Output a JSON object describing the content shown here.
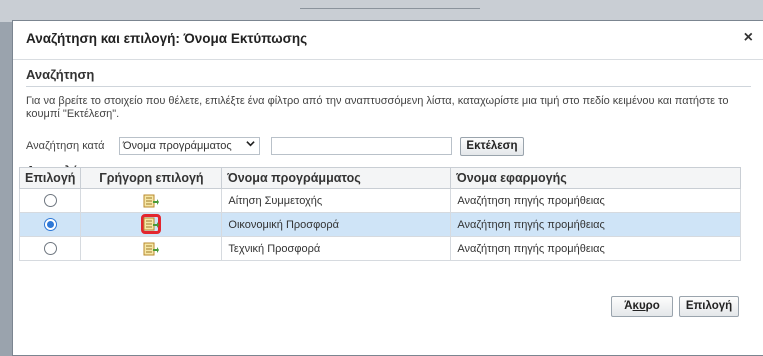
{
  "dialog": {
    "title": "Αναζήτηση και επιλογή: Όνομα Εκτύπωσης",
    "close_glyph": "×"
  },
  "search": {
    "section_title": "Αναζήτηση",
    "help_text": "Για να βρείτε το στοιχείο που θέλετε, επιλέξτε ένα φίλτρο από την αναπτυσσόμενη λίστα, καταχωρίστε μια τιμή στο πεδίο κειμένου και πατήστε το κουμπί \"Εκτέλεση\".",
    "search_by_label": "Αναζήτηση κατά",
    "filter_selected": "Όνομα προγράμματος",
    "value": "",
    "execute_label": "Εκτέλεση"
  },
  "results": {
    "section_title": "Αποτελέσματα",
    "columns": [
      "Επιλογή",
      "Γρήγορη επιλογή",
      "Όνομα προγράμματος",
      "Όνομα εφαρμογής"
    ],
    "rows": [
      {
        "program": "Αίτηση Συμμετοχής",
        "application": "Αναζήτηση πηγής προμήθειας",
        "selected": false
      },
      {
        "program": "Οικονομική Προσφορά",
        "application": "Αναζήτηση πηγής προμήθειας",
        "selected": true
      },
      {
        "program": "Τεχνική Προσφορά",
        "application": "Αναζήτηση πηγής προμήθειας",
        "selected": false
      }
    ]
  },
  "footer": {
    "cancel_prefix": "Ά",
    "cancel_underlined": "κυ",
    "cancel_suffix": "ρο",
    "select_label": "Επιλογή"
  },
  "colors": {
    "selected_row": "#cfe4f7",
    "highlight_box": "#e3262e",
    "radio_checked": "#2f78d6"
  },
  "icons": {
    "quick_select": "quick-select-icon",
    "close": "close-icon",
    "dropdown": "chevron-down-icon"
  }
}
